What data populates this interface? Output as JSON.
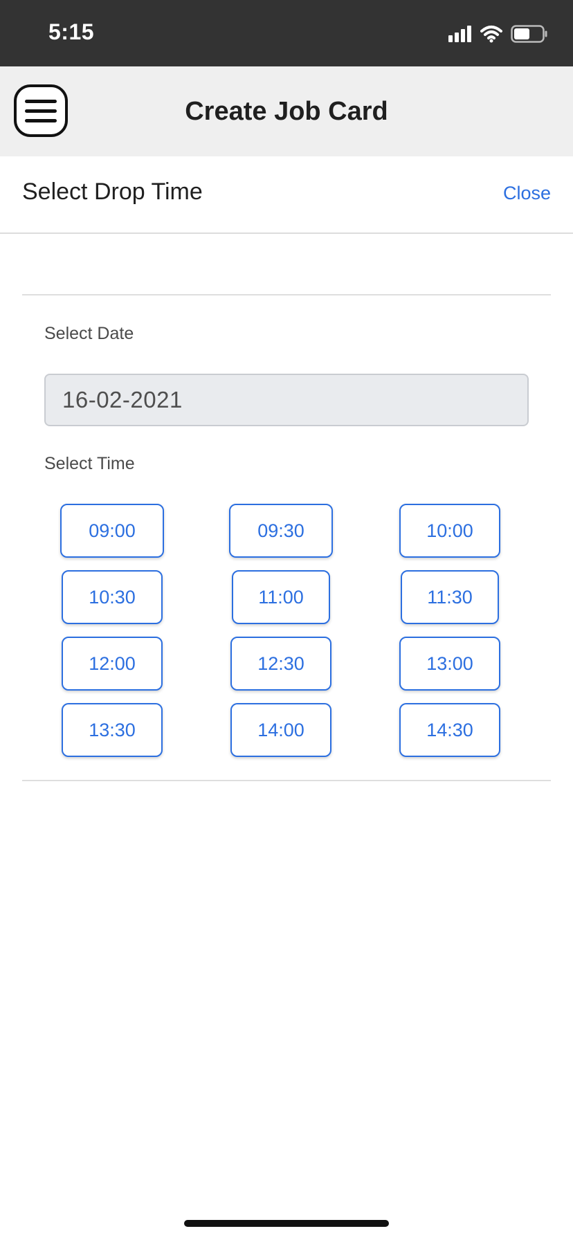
{
  "status_bar": {
    "time": "5:15",
    "icons": [
      "cellular-signal-icon",
      "wifi-icon",
      "battery-icon"
    ]
  },
  "nav": {
    "title": "Create Job Card",
    "menu_icon": "menu-icon"
  },
  "modal": {
    "title": "Select Drop Time",
    "close_label": "Close"
  },
  "form": {
    "date_label": "Select Date",
    "date_value": "16-02-2021",
    "time_label": "Select Time"
  },
  "time_slots": [
    [
      "09:00",
      "09:30",
      "10:00"
    ],
    [
      "10:30",
      "11:00",
      "11:30"
    ],
    [
      "12:00",
      "12:30",
      "13:00"
    ],
    [
      "13:30",
      "14:00",
      "14:30"
    ]
  ],
  "colors": {
    "accent": "#2c6fe0",
    "status_bar": "#333333",
    "nav_bar": "#efefef"
  }
}
